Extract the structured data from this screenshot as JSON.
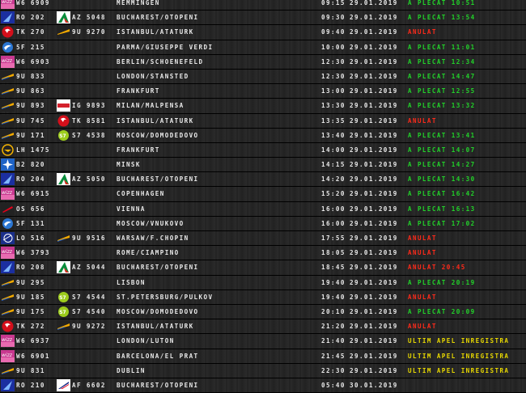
{
  "colors": {
    "departed": "#22d22a",
    "cancelled": "#ff2a1a",
    "delayed": "#ff2a1a",
    "boarding": "#e8d800",
    "text": "#e8e8e8"
  },
  "flights": [
    {
      "logo": "wizz-logo",
      "code": "W6 6909",
      "logo2": "",
      "code2": "",
      "destination": "MEMMINGEN",
      "time": "09:15",
      "date": "29.01.2019",
      "status": "A PLECAT 10:51",
      "status_type": "departed"
    },
    {
      "logo": "tarom-logo",
      "code": "RO 202",
      "logo2": "alitalia-logo",
      "code2": "AZ 5048",
      "destination": "BUCHAREST/OTOPENI",
      "time": "09:30",
      "date": "29.01.2019",
      "status": "A PLECAT 13:54",
      "status_type": "departed"
    },
    {
      "logo": "turkish-logo",
      "code": "TK 270",
      "logo2": "ukraine-intl-logo",
      "code2": "9U 9270",
      "destination": "ISTANBUL/ATATURK",
      "time": "09:40",
      "date": "29.01.2019",
      "status": "ANULAT",
      "status_type": "cancelled"
    },
    {
      "logo": "s7-blue-logo",
      "code": "5F 215",
      "logo2": "",
      "code2": "",
      "destination": "PARMA/GIUSEPPE VERDI",
      "time": "10:00",
      "date": "29.01.2019",
      "status": "A PLECAT 11:01",
      "status_type": "departed"
    },
    {
      "logo": "wizz-logo",
      "code": "W6 6903",
      "logo2": "",
      "code2": "",
      "destination": "BERLIN/SCHOENEFELD",
      "time": "12:30",
      "date": "29.01.2019",
      "status": "A PLECAT 12:34",
      "status_type": "departed"
    },
    {
      "logo": "airmoldova-logo",
      "code": "9U 833",
      "logo2": "",
      "code2": "",
      "destination": "LONDON/STANSTED",
      "time": "12:30",
      "date": "29.01.2019",
      "status": "A PLECAT 14:47",
      "status_type": "departed"
    },
    {
      "logo": "airmoldova-logo",
      "code": "9U 863",
      "logo2": "",
      "code2": "",
      "destination": "FRANKFURT",
      "time": "13:00",
      "date": "29.01.2019",
      "status": "A PLECAT 12:55",
      "status_type": "departed"
    },
    {
      "logo": "airmoldova-logo",
      "code": "9U 893",
      "logo2": "smallred-logo",
      "code2": "IG 9893",
      "destination": "MILAN/MALPENSA",
      "time": "13:30",
      "date": "29.01.2019",
      "status": "A PLECAT 13:32",
      "status_type": "departed"
    },
    {
      "logo": "airmoldova-logo",
      "code": "9U 745",
      "logo2": "turkish-logo",
      "code2": "TK 8581",
      "destination": "ISTANBUL/ATATURK",
      "time": "13:35",
      "date": "29.01.2019",
      "status": "ANULAT",
      "status_type": "cancelled"
    },
    {
      "logo": "airmoldova-logo",
      "code": "9U 171",
      "logo2": "s7-logo",
      "code2": "S7 4538",
      "destination": "MOSCOW/DOMODEDOVO",
      "time": "13:40",
      "date": "29.01.2019",
      "status": "A PLECAT 13:41",
      "status_type": "departed"
    },
    {
      "logo": "lufthansa-logo",
      "code": "LH 1475",
      "logo2": "",
      "code2": "",
      "destination": "FRANKFURT",
      "time": "14:00",
      "date": "29.01.2019",
      "status": "A PLECAT 14:07",
      "status_type": "departed"
    },
    {
      "logo": "belavia-logo",
      "code": "B2 820",
      "logo2": "",
      "code2": "",
      "destination": "MINSK",
      "time": "14:15",
      "date": "29.01.2019",
      "status": "A PLECAT 14:27",
      "status_type": "departed"
    },
    {
      "logo": "tarom-logo",
      "code": "RO 204",
      "logo2": "alitalia-logo",
      "code2": "AZ 5050",
      "destination": "BUCHAREST/OTOPENI",
      "time": "14:20",
      "date": "29.01.2019",
      "status": "A PLECAT 14:30",
      "status_type": "departed"
    },
    {
      "logo": "wizz-logo",
      "code": "W6 6915",
      "logo2": "",
      "code2": "",
      "destination": "COPENHAGEN",
      "time": "15:20",
      "date": "29.01.2019",
      "status": "A PLECAT 16:42",
      "status_type": "departed"
    },
    {
      "logo": "austrian-logo",
      "code": "OS 656",
      "logo2": "",
      "code2": "",
      "destination": "VIENNA",
      "time": "16:00",
      "date": "29.01.2019",
      "status": "A PLECAT 16:13",
      "status_type": "departed"
    },
    {
      "logo": "s7-blue-logo",
      "code": "5F 131",
      "logo2": "",
      "code2": "",
      "destination": "MOSCOW/VNUKOVO",
      "time": "16:00",
      "date": "29.01.2019",
      "status": "A PLECAT 17:02",
      "status_type": "departed"
    },
    {
      "logo": "lot-logo",
      "code": "LO 516",
      "logo2": "airmoldova-logo",
      "code2": "9U 9516",
      "destination": "WARSAW/F.CHOPIN",
      "time": "17:55",
      "date": "29.01.2019",
      "status": "ANULAT",
      "status_type": "cancelled"
    },
    {
      "logo": "wizz-logo",
      "code": "W6 3793",
      "logo2": "",
      "code2": "",
      "destination": "ROME/CIAMPINO",
      "time": "18:05",
      "date": "29.01.2019",
      "status": "ANULAT",
      "status_type": "cancelled"
    },
    {
      "logo": "tarom-logo",
      "code": "RO 208",
      "logo2": "alitalia-logo",
      "code2": "AZ 5044",
      "destination": "BUCHAREST/OTOPENI",
      "time": "18:45",
      "date": "29.01.2019",
      "status": "ANULAT 20:45",
      "status_type": "delayed"
    },
    {
      "logo": "airmoldova-logo",
      "code": "9U 295",
      "logo2": "",
      "code2": "",
      "destination": "LISBON",
      "time": "19:40",
      "date": "29.01.2019",
      "status": "A PLECAT 20:19",
      "status_type": "departed"
    },
    {
      "logo": "airmoldova-logo",
      "code": "9U 185",
      "logo2": "s7-logo",
      "code2": "S7 4544",
      "destination": "ST.PETERSBURG/PULKOV",
      "time": "19:40",
      "date": "29.01.2019",
      "status": "ANULAT",
      "status_type": "cancelled"
    },
    {
      "logo": "airmoldova-logo",
      "code": "9U 175",
      "logo2": "s7-logo",
      "code2": "S7 4540",
      "destination": "MOSCOW/DOMODEDOVO",
      "time": "20:10",
      "date": "29.01.2019",
      "status": "A PLECAT 20:09",
      "status_type": "departed"
    },
    {
      "logo": "turkish-logo",
      "code": "TK 272",
      "logo2": "airmoldova-logo",
      "code2": "9U 9272",
      "destination": "ISTANBUL/ATATURK",
      "time": "21:20",
      "date": "29.01.2019",
      "status": "ANULAT",
      "status_type": "cancelled"
    },
    {
      "logo": "wizz-logo",
      "code": "W6 6937",
      "logo2": "",
      "code2": "",
      "destination": "LONDON/LUTON",
      "time": "21:40",
      "date": "29.01.2019",
      "status": "ULTIM APEL INREGISTRA",
      "status_type": "boarding"
    },
    {
      "logo": "wizz-logo",
      "code": "W6 6901",
      "logo2": "",
      "code2": "",
      "destination": "BARCELONA/EL PRAT",
      "time": "21:45",
      "date": "29.01.2019",
      "status": "ULTIM APEL INREGISTRA",
      "status_type": "boarding"
    },
    {
      "logo": "airmoldova-logo",
      "code": "9U 831",
      "logo2": "",
      "code2": "",
      "destination": "DUBLIN",
      "time": "22:30",
      "date": "29.01.2019",
      "status": "ULTIM APEL INREGISTRA",
      "status_type": "boarding"
    },
    {
      "logo": "tarom-logo",
      "code": "RO 210",
      "logo2": "airfrance-logo",
      "code2": "AF 6602",
      "destination": "BUCHAREST/OTOPENI",
      "time": "05:40",
      "date": "30.01.2019",
      "status": "",
      "status_type": "scheduled"
    }
  ]
}
